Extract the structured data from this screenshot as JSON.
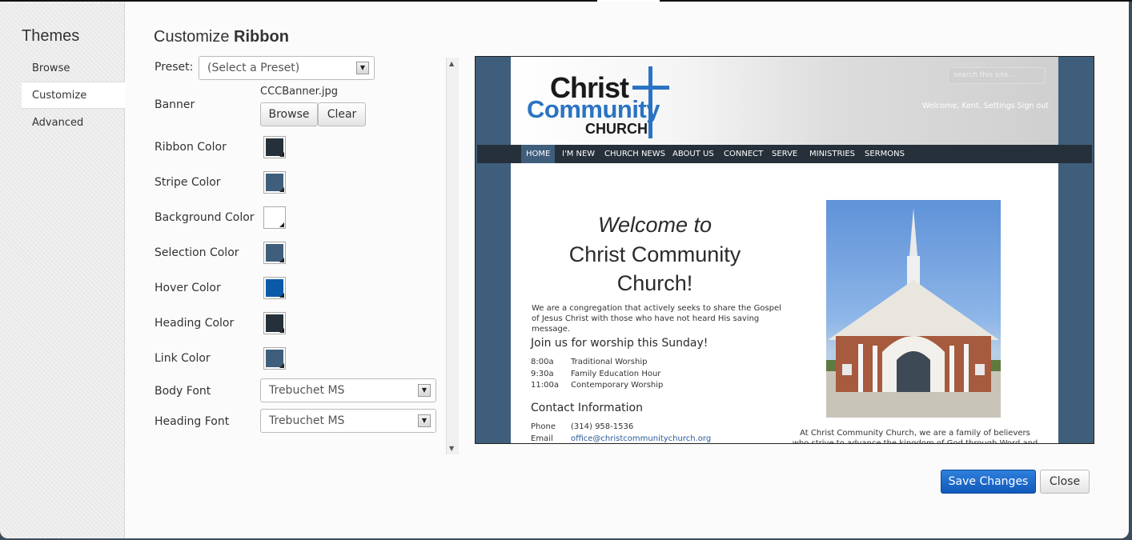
{
  "sidebar": {
    "title": "Themes",
    "items": [
      {
        "label": "Browse"
      },
      {
        "label": "Customize"
      },
      {
        "label": "Advanced"
      }
    ]
  },
  "main": {
    "title_prefix": "Customize",
    "title_bold": "Ribbon",
    "preset_label": "Preset:",
    "preset_value": "(Select a Preset)",
    "banner_label": "Banner",
    "banner_file": "CCCBanner.jpg",
    "browse_label": "Browse",
    "clear_label": "Clear",
    "colors": [
      {
        "label": "Ribbon Color",
        "value": "#25303a"
      },
      {
        "label": "Stripe Color",
        "value": "#3f5e7c"
      },
      {
        "label": "Background Color",
        "value": "#ffffff"
      },
      {
        "label": "Selection Color",
        "value": "#3f5e7c"
      },
      {
        "label": "Hover Color",
        "value": "#0b5aa8"
      },
      {
        "label": "Heading Color",
        "value": "#25303a"
      },
      {
        "label": "Link Color",
        "value": "#3f5e7c"
      }
    ],
    "body_font_label": "Body Font",
    "body_font_value": "Trebuchet MS",
    "heading_font_label": "Heading Font",
    "heading_font_value": "Trebuchet MS"
  },
  "preview": {
    "logo_line1": "Christ",
    "logo_line2": "Community",
    "logo_line3": "CHURCH",
    "search_placeholder": "search this site...",
    "welcome": "Welcome, Kent. Settings Sign out",
    "nav": [
      "HOME",
      "I'M NEW",
      "CHURCH NEWS",
      "ABOUT US",
      "CONNECT",
      "SERVE",
      "MINISTRIES",
      "SERMONS"
    ],
    "welcome_heading": "Welcome to",
    "church_name": "Christ Community Church!",
    "intro": "We are a congregation that actively seeks to share the Gospel of Jesus Christ with those who have not heard His saving message.",
    "worship_heading": "Join us for worship this Sunday!",
    "schedule": [
      {
        "time": "8:00a",
        "event": "Traditional Worship"
      },
      {
        "time": "9:30a",
        "event": "Family Education Hour"
      },
      {
        "time": "11:00a",
        "event": "Contemporary Worship"
      }
    ],
    "contact_heading": "Contact Information",
    "contact": [
      {
        "label": "Phone",
        "value": "(314) 958-1536"
      },
      {
        "label": "Email",
        "value": "office@christcommunitychurch.org"
      }
    ],
    "about": "At Christ Community Church, we are a family of believers who strive to advance the kingdom of God through Word and"
  },
  "footer": {
    "save_label": "Save Changes",
    "close_label": "Close"
  }
}
